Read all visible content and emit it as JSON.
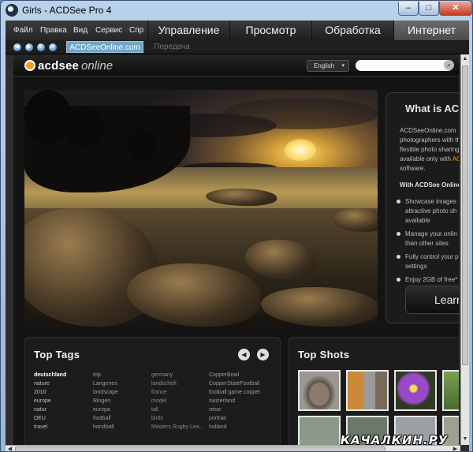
{
  "window": {
    "title": "Girls - ACDSee Pro 4",
    "controls": {
      "minimize": "–",
      "maximize": "□",
      "close": "✕"
    }
  },
  "menu": {
    "items": [
      "Файл",
      "Правка",
      "Вид",
      "Сервис",
      "Спр"
    ],
    "modes": [
      "Управление",
      "Просмотр",
      "Обработка",
      "Интернет"
    ],
    "active_mode": "Интернет"
  },
  "nav": {
    "buttons": [
      {
        "icon": "back-icon",
        "glyph": "◀"
      },
      {
        "icon": "forward-icon",
        "glyph": "▶"
      },
      {
        "icon": "refresh-icon",
        "glyph": "↻"
      },
      {
        "icon": "stop-icon",
        "glyph": "✕"
      }
    ],
    "tabs": [
      "ACDSeeOnline.com",
      "Передача"
    ],
    "active_tab": "ACDSeeOnline.com"
  },
  "site": {
    "logo_brand": "acdsee",
    "logo_suffix": "online",
    "language": "English",
    "search_value": "",
    "accent": "#f0a21b"
  },
  "info": {
    "title": "What is ACD",
    "para_lines": [
      "ACDSeeOnline.com",
      "photographers with th",
      "flexible photo sharing",
      "available only with AC",
      "software."
    ],
    "sub_title": "With ACDSee Online",
    "bullets": [
      "Showcase images",
      "attractive photo sh",
      "available",
      "Manage your onlin",
      "than other sites",
      "Fully control your p",
      "settings",
      "Enjoy 2GB of free*"
    ],
    "cta": "Learn"
  },
  "top_tags": {
    "title": "Top Tags",
    "columns": [
      [
        "deutschland",
        "nature",
        "2010",
        "europe",
        "natur",
        "DEU",
        "travel"
      ],
      [
        "trip",
        "Langenes",
        "landscape",
        "Ringen",
        "europa",
        "football",
        "handball"
      ],
      [
        "germany",
        "landscheft",
        "france",
        "model",
        "tall",
        "birds",
        "Masters Rugby Lea..."
      ],
      [
        "CopperBowl",
        "CopperStateFootball",
        "football game copper",
        "swizerland",
        "reise",
        "portrait",
        "holland"
      ]
    ]
  },
  "top_shots": {
    "title": "Top Shots",
    "thumbs": [
      {
        "icon": "bird-photo"
      },
      {
        "icon": "kittens-photo"
      },
      {
        "icon": "crocus-flowers-photo"
      },
      {
        "icon": "green-photo"
      }
    ]
  },
  "watermark": "КАЧАЛКИН.РУ"
}
